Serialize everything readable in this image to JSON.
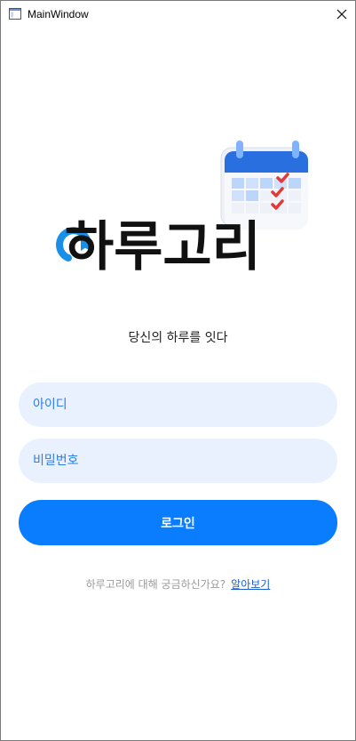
{
  "window": {
    "title": "MainWindow"
  },
  "logo": {
    "wordmark": "하루고리"
  },
  "tagline": "당신의 하루를 잇다",
  "login_form": {
    "id_placeholder": "아이디",
    "password_placeholder": "비밀번호",
    "login_label": "로그인"
  },
  "footer": {
    "question": "하루고리에 대해 궁금하신가요?",
    "link_label": "알아보기"
  },
  "colors": {
    "accent": "#0a7dff",
    "input_bg": "#e8f1fd",
    "input_text": "#2f7de0",
    "logo_text": "#111111",
    "link": "#1a5fd0"
  }
}
